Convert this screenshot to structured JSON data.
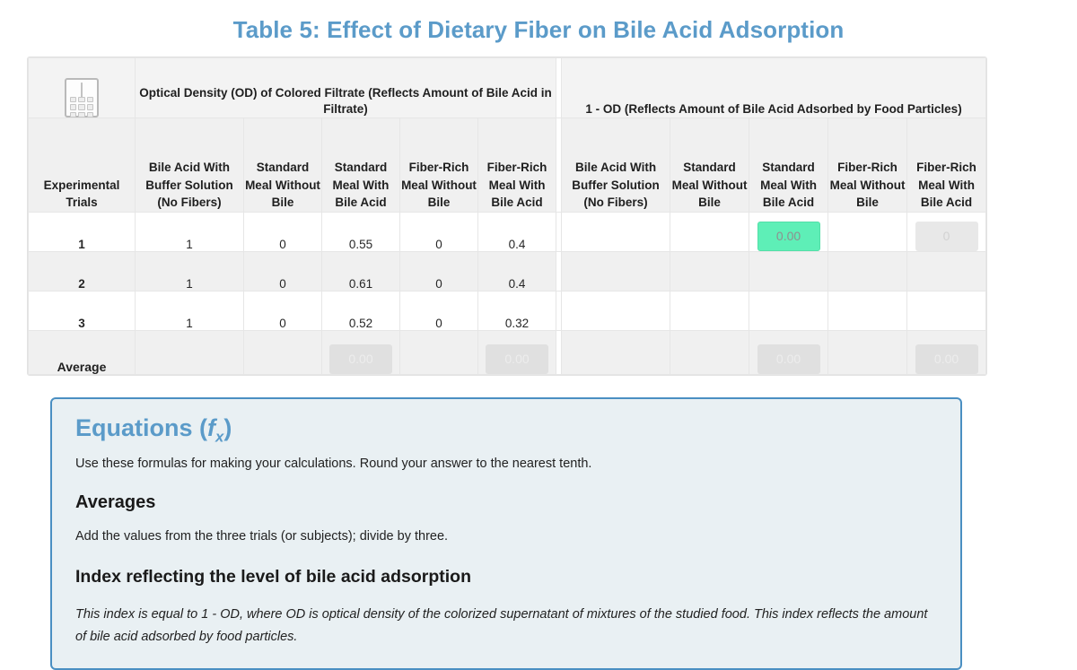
{
  "page": {
    "title": "Table 5: Effect of Dietary Fiber on Bile Acid Adsorption",
    "title_color": "#5b9bc9"
  },
  "table": {
    "corner_icon": "calculator-icon",
    "group_headers": [
      "Optical Density (OD) of Colored Filtrate (Reflects Amount of Bile Acid in Filtrate)",
      "1 - OD (Reflects Amount of Bile Acid Adsorbed by Food Particles)"
    ],
    "columns": [
      "Experimental Trials",
      "Bile Acid With Buffer Solution (No Fibers)",
      "Standard Meal Without Bile",
      "Standard Meal With Bile Acid",
      "Fiber-Rich Meal Without Bile",
      "Fiber-Rich Meal With Bile Acid",
      "Bile Acid With Buffer Solution (No Fibers)",
      "Standard Meal Without Bile",
      "Standard Meal With Bile Acid",
      "Fiber-Rich Meal Without Bile",
      "Fiber-Rich Meal With Bile Acid"
    ],
    "rows": [
      {
        "label": "1",
        "od": [
          "1",
          "0",
          "0.55",
          "0",
          "0.4"
        ],
        "adsorbed": [
          "",
          "",
          "0.00",
          "",
          "0"
        ]
      },
      {
        "label": "2",
        "od": [
          "1",
          "0",
          "0.61",
          "0",
          "0.4"
        ],
        "adsorbed": [
          "",
          "",
          "",
          "",
          ""
        ]
      },
      {
        "label": "3",
        "od": [
          "1",
          "0",
          "0.52",
          "0",
          "0.32"
        ],
        "adsorbed": [
          "",
          "",
          "",
          "",
          ""
        ]
      }
    ],
    "average_row": {
      "label": "Average",
      "od": [
        "",
        "",
        "0.00",
        "",
        "0.00"
      ],
      "adsorbed": [
        "",
        "",
        "0.00",
        "",
        "0.00"
      ]
    },
    "highlight_color": "#5eefb7"
  },
  "equations": {
    "title_main": "Equations",
    "title_fx_f": "f",
    "title_fx_sub": "x",
    "lead": "Use these formulas for making your calculations. Round your answer to the nearest tenth.",
    "section_1_heading": "Averages",
    "section_1_text": "Add the values from the three trials (or subjects); divide by three.",
    "section_2_heading": "Index reflecting the level of bile acid adsorption",
    "section_2_text": "This index is equal to 1 - OD, where OD is optical density of the colorized supernatant of mixtures of the studied food. This index reflects the amount of bile acid adsorbed by food particles.",
    "border_color": "#4a8fc2",
    "background_color": "#e9f0f3"
  }
}
